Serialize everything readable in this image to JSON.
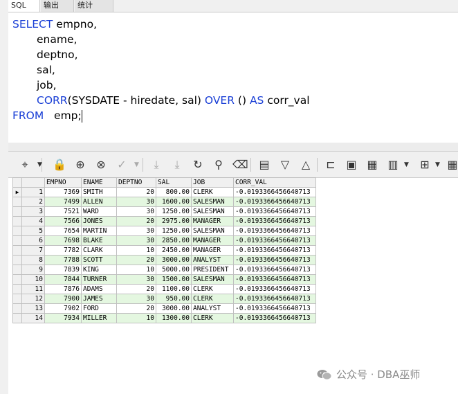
{
  "tabs": [
    {
      "label": "SQL",
      "active": true
    },
    {
      "label": "输出",
      "active": false
    },
    {
      "label": "统计",
      "active": false
    }
  ],
  "editor": {
    "lines": [
      {
        "kw": "SELECT",
        "text": " empno,"
      },
      {
        "kw": "",
        "text": "ename,"
      },
      {
        "kw": "",
        "text": "deptno,"
      },
      {
        "kw": "",
        "text": "sal,"
      },
      {
        "kw": "",
        "text": "job,"
      },
      {
        "kw": "CORR",
        "text": "(SYSDATE - hiredate, sal) OVER () AS corr_val"
      },
      {
        "kw": "FROM",
        "text": "   emp;"
      }
    ]
  },
  "grid": {
    "columns": [
      "EMPNO",
      "ENAME",
      "DEPTNO",
      "SAL",
      "JOB",
      "CORR_VAL"
    ],
    "rows": [
      [
        "1",
        "7369",
        "SMITH",
        "20",
        "800.00",
        "CLERK",
        "-0.0193366456640713"
      ],
      [
        "2",
        "7499",
        "ALLEN",
        "30",
        "1600.00",
        "SALESMAN",
        "-0.0193366456640713"
      ],
      [
        "3",
        "7521",
        "WARD",
        "30",
        "1250.00",
        "SALESMAN",
        "-0.0193366456640713"
      ],
      [
        "4",
        "7566",
        "JONES",
        "20",
        "2975.00",
        "MANAGER",
        "-0.0193366456640713"
      ],
      [
        "5",
        "7654",
        "MARTIN",
        "30",
        "1250.00",
        "SALESMAN",
        "-0.0193366456640713"
      ],
      [
        "6",
        "7698",
        "BLAKE",
        "30",
        "2850.00",
        "MANAGER",
        "-0.0193366456640713"
      ],
      [
        "7",
        "7782",
        "CLARK",
        "10",
        "2450.00",
        "MANAGER",
        "-0.0193366456640713"
      ],
      [
        "8",
        "7788",
        "SCOTT",
        "20",
        "3000.00",
        "ANALYST",
        "-0.0193366456640713"
      ],
      [
        "9",
        "7839",
        "KING",
        "10",
        "5000.00",
        "PRESIDENT",
        "-0.0193366456640713"
      ],
      [
        "10",
        "7844",
        "TURNER",
        "30",
        "1500.00",
        "SALESMAN",
        "-0.0193366456640713"
      ],
      [
        "11",
        "7876",
        "ADAMS",
        "20",
        "1100.00",
        "CLERK",
        "-0.0193366456640713"
      ],
      [
        "12",
        "7900",
        "JAMES",
        "30",
        "950.00",
        "CLERK",
        "-0.0193366456640713"
      ],
      [
        "13",
        "7902",
        "FORD",
        "20",
        "3000.00",
        "ANALYST",
        "-0.0193366456640713"
      ],
      [
        "14",
        "7934",
        "MILLER",
        "10",
        "1300.00",
        "CLERK",
        "-0.0193366456640713"
      ]
    ],
    "current_row_marker": "▶",
    "alt_row_color": "#e4f7e0",
    "keyword_color": "#1a3fd6"
  },
  "toolbar": {
    "buttons": [
      {
        "icon": "⌖",
        "name": "query-mode-icon",
        "dim": false
      },
      {
        "icon": "🔒",
        "name": "lock-icon",
        "dim": false
      },
      {
        "icon": "⊕",
        "name": "add-record-icon",
        "dim": false
      },
      {
        "icon": "⊗",
        "name": "delete-record-icon",
        "dim": false
      },
      {
        "icon": "✓",
        "name": "post-changes-icon",
        "dim": true
      },
      {
        "icon": "⤓",
        "name": "fetch-next-icon",
        "dim": true
      },
      {
        "icon": "⤓",
        "name": "fetch-last-icon",
        "dim": true
      },
      {
        "icon": "↻",
        "name": "refresh-icon",
        "dim": false
      },
      {
        "icon": "⚲",
        "name": "find-icon",
        "dim": false
      },
      {
        "icon": "⌫",
        "name": "clear-icon",
        "dim": false
      },
      {
        "icon": "▤",
        "name": "single-record-view-icon",
        "dim": false
      },
      {
        "icon": "▽",
        "name": "filter-icon",
        "dim": false
      },
      {
        "icon": "△",
        "name": "sort-icon",
        "dim": false
      },
      {
        "icon": "⊏",
        "name": "export-icon",
        "dim": false
      },
      {
        "icon": "▣",
        "name": "print-icon",
        "dim": false
      },
      {
        "icon": "▦",
        "name": "query-by-example-icon",
        "dim": false
      },
      {
        "icon": "▥",
        "name": "chart-icon",
        "dim": false
      },
      {
        "icon": "⊞",
        "name": "columns-icon",
        "dim": false
      },
      {
        "icon": "▦",
        "name": "grid-view-icon",
        "dim": false
      }
    ],
    "dropdown_glyph": "▼"
  },
  "watermark": {
    "text": "公众号 · DBA巫师",
    "icon": "wechat-icon"
  }
}
